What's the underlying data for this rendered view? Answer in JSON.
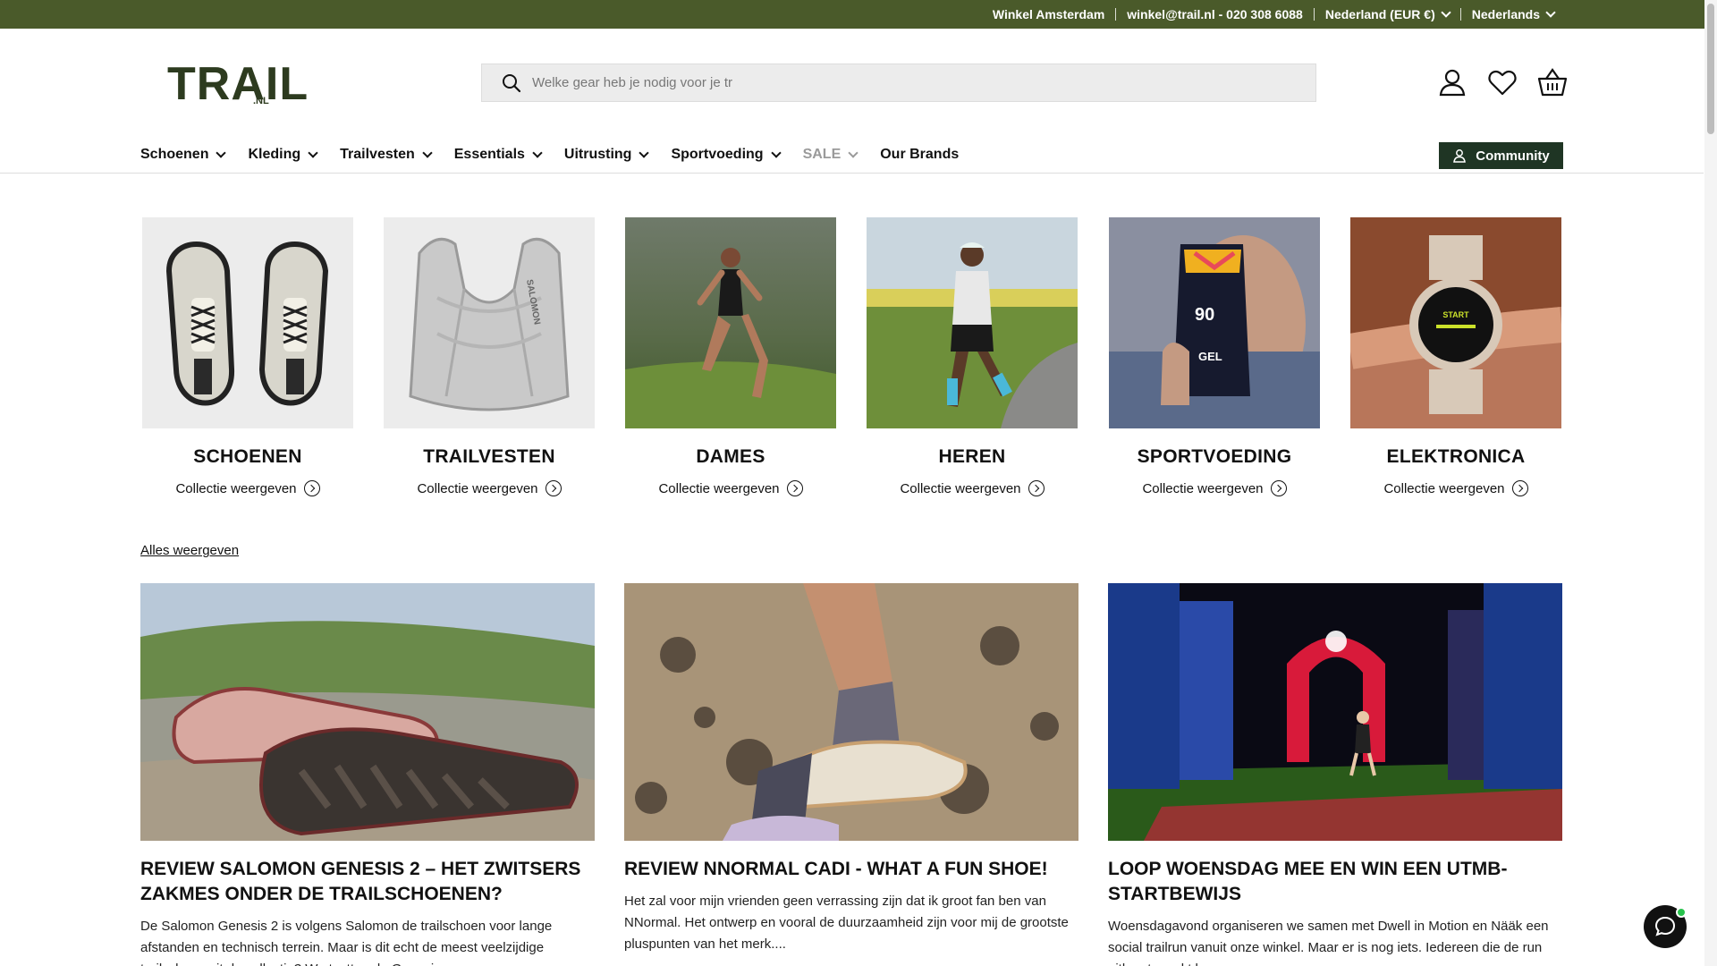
{
  "topbar": {
    "store": "Winkel Amsterdam",
    "contact": "winkel@trail.nl - 020 308 6088",
    "region": "Nederland (EUR €)",
    "language": "Nederlands"
  },
  "logo": {
    "text": "TRAIL",
    "suffix": ".NL"
  },
  "search": {
    "placeholder": "Welke gear heb je nodig voor je tr"
  },
  "header_icons": [
    "account-icon",
    "wishlist-icon",
    "basket-icon"
  ],
  "nav": {
    "items": [
      {
        "label": "Schoenen",
        "has_dropdown": true
      },
      {
        "label": "Kleding",
        "has_dropdown": true
      },
      {
        "label": "Trailvesten",
        "has_dropdown": true
      },
      {
        "label": "Essentials",
        "has_dropdown": true
      },
      {
        "label": "Uitrusting",
        "has_dropdown": true
      },
      {
        "label": "Sportvoeding",
        "has_dropdown": true
      },
      {
        "label": "SALE",
        "has_dropdown": true
      },
      {
        "label": "Our Brands",
        "has_dropdown": false
      }
    ],
    "community": "Community"
  },
  "categories": [
    {
      "title": "SCHOENEN",
      "link": "Collectie weergeven"
    },
    {
      "title": "TRAILVESTEN",
      "link": "Collectie weergeven"
    },
    {
      "title": "DAMES",
      "link": "Collectie weergeven"
    },
    {
      "title": "HEREN",
      "link": "Collectie weergeven"
    },
    {
      "title": "SPORTVOEDING",
      "link": "Collectie weergeven"
    },
    {
      "title": "ELEKTRONICA",
      "link": "Collectie weergeven"
    }
  ],
  "all_link": "Alles weergeven",
  "blog": [
    {
      "title": "Review Salomon Genesis 2 – Het Zwitsers zakmes onder de trailschoenen?",
      "excerpt": "De Salomon Genesis 2 is volgens Salomon de trailschoen voor lange afstanden en technisch terrein. Maar is dit echt de meest veelzijdige trailschoen uit de collectie? We testten de Genesis..."
    },
    {
      "title": "Review NNormal Cadi - What a fun shoe!",
      "excerpt": "Het zal voor mijn vrienden geen verrassing zijn dat ik groot fan ben van NNormal. Het ontwerp en vooral de duurzaamheid zijn voor mij de grootste pluspunten van het merk...."
    },
    {
      "title": "Loop woensdag mee en win een UTMB-startbewijs",
      "excerpt": "Woensdagavond organiseren we samen met Dwell in Motion en Nääk een social trailrun vanuit onze winkel.  Maar er is nog iets. Iedereen die de run uitloopt maakt kans..."
    }
  ],
  "colors": {
    "topbar": "#4a5a2a",
    "community": "#1f3524",
    "logo": "#2d3b1f",
    "accent": "#7b8c3a"
  }
}
